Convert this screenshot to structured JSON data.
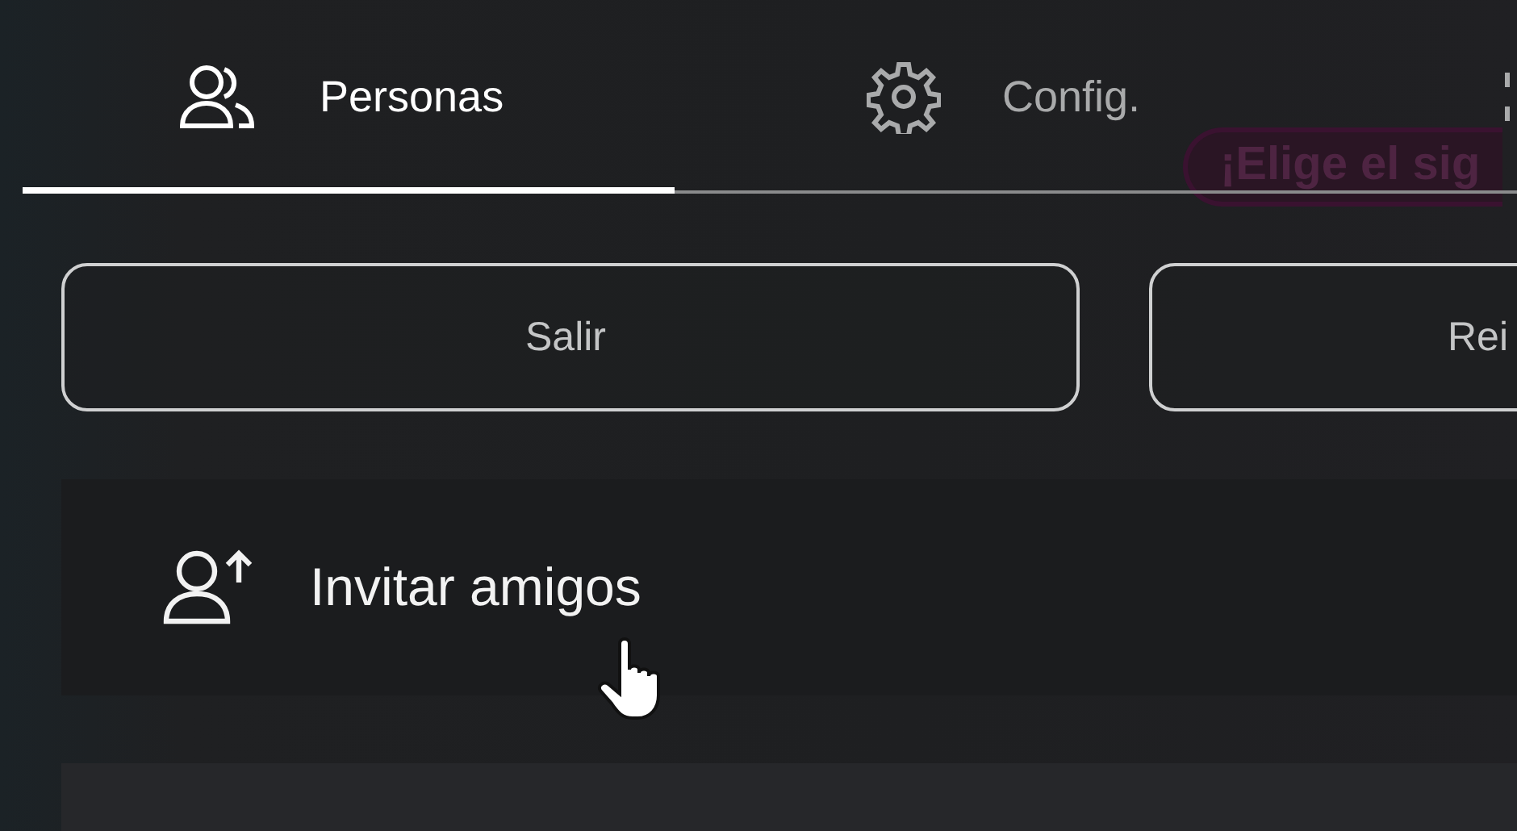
{
  "background_sign": {
    "text": "¡Elige el sig"
  },
  "tabs": [
    {
      "kind": "people",
      "label": "Personas",
      "selected": true
    },
    {
      "kind": "gear",
      "label": "Config.",
      "selected": false
    },
    {
      "kind": "expand",
      "selected": false
    }
  ],
  "buttons": [
    {
      "label": "Salir"
    },
    {
      "label": "Rei"
    }
  ],
  "actions": [
    {
      "kind": "invite",
      "label": "Invitar amigos",
      "hovered": true
    }
  ]
}
